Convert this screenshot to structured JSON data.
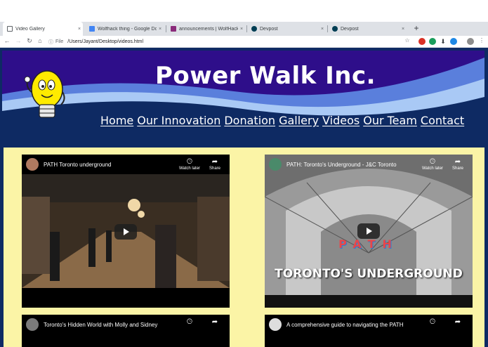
{
  "browser": {
    "tabs": [
      {
        "title": "Video Gallery",
        "close": "×"
      },
      {
        "title": "Wolfhack thing - Google Docs",
        "close": "×"
      },
      {
        "title": "announcements | WolfHacks",
        "close": "×"
      },
      {
        "title": "Devpost",
        "close": "×"
      },
      {
        "title": "Devpost",
        "close": "×"
      }
    ],
    "new_tab": "+",
    "address": {
      "scheme": "File",
      "path": "/Users/Jayant/Desktop/videos.html"
    }
  },
  "site": {
    "title": "Power Walk Inc.",
    "nav": [
      "Home",
      "Our Innovation",
      "Donation",
      "Gallery",
      "Videos",
      "Our Team",
      "Contact"
    ]
  },
  "videos": [
    {
      "title": "PATH Toronto underground",
      "watch_later": "Watch later",
      "share": "Share"
    },
    {
      "title": "PATH: Toronto's Underground - J&C Toronto",
      "watch_later": "Watch later",
      "share": "Share",
      "overlay_text": "TORONTO'S UNDERGROUND",
      "logo_letters": "PATH"
    },
    {
      "title": "Toronto's Hidden World with Molly and Sidney",
      "watch_later": "",
      "share": ""
    },
    {
      "title": "A comprehensive guide to navigating the PATH",
      "watch_later": "",
      "share": ""
    }
  ],
  "colors": {
    "header_bg": "#2e0e8a",
    "page_bg": "#0e2a63",
    "content_bg": "#fbf4a6",
    "wave_light": "#a9c9f5",
    "wave_mid": "#5a7fdc"
  }
}
